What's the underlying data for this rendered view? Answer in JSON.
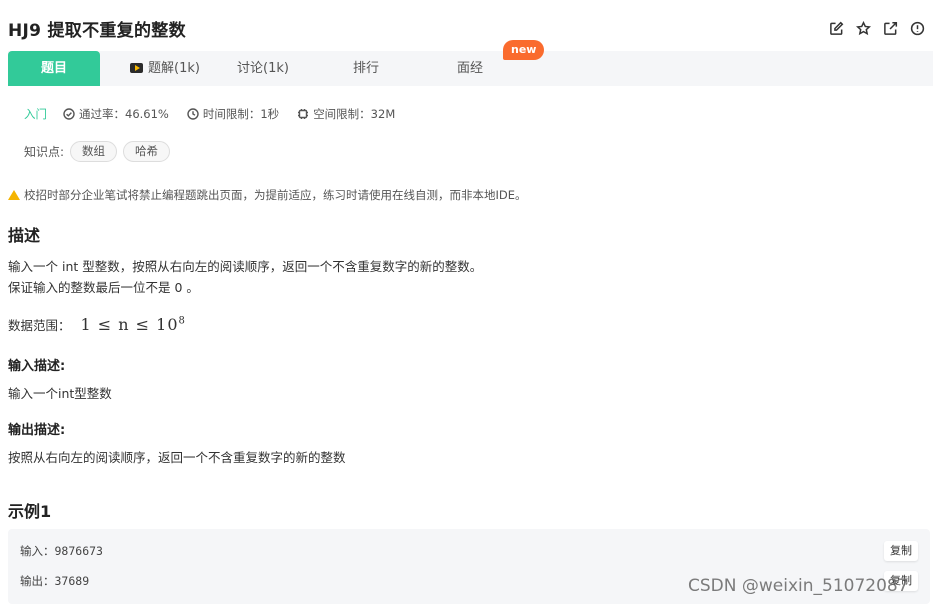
{
  "header": {
    "title": "HJ9  提取不重复的整数",
    "icons": [
      "edit-icon",
      "star-icon",
      "external-link-icon",
      "info-icon"
    ]
  },
  "tabs": [
    {
      "label": "题目",
      "active": true
    },
    {
      "label": "题解(1k)",
      "icon": "video-icon"
    },
    {
      "label": "讨论(1k)"
    },
    {
      "label": "排行"
    },
    {
      "label": "面经"
    }
  ],
  "new_badge": "new",
  "meta": {
    "level": "入门",
    "pass_rate": "通过率：46.61%",
    "time_limit": "时间限制：1秒",
    "memory_limit": "空间限制：32M"
  },
  "knowledge": {
    "label": "知识点:",
    "tags": [
      "数组",
      "哈希"
    ]
  },
  "warning": "校招时部分企业笔试将禁止编程题跳出页面，为提前适应，练习时请使用在线自测，而非本地IDE。",
  "description": {
    "heading": "描述",
    "line1": "输入一个 int 型整数，按照从右向左的阅读顺序，返回一个不含重复数字的新的整数。",
    "line2": "保证输入的整数最后一位不是 0 。",
    "range_label": "数据范围：",
    "range_math": "1 ≤ n ≤ 10",
    "range_exp": "8"
  },
  "input_desc": {
    "heading": "输入描述:",
    "text": "输入一个int型整数"
  },
  "output_desc": {
    "heading": "输出描述:",
    "text": "按照从右向左的阅读顺序，返回一个不含重复数字的新的整数"
  },
  "example": {
    "heading": "示例1",
    "input": "输入：9876673",
    "output": "输出：37689",
    "copy_label": "复制"
  },
  "watermark": "CSDN @weixin_51072087",
  "colors": {
    "accent": "#32ca99",
    "badge": "#fa6b2e",
    "warning": "#f5b400"
  }
}
